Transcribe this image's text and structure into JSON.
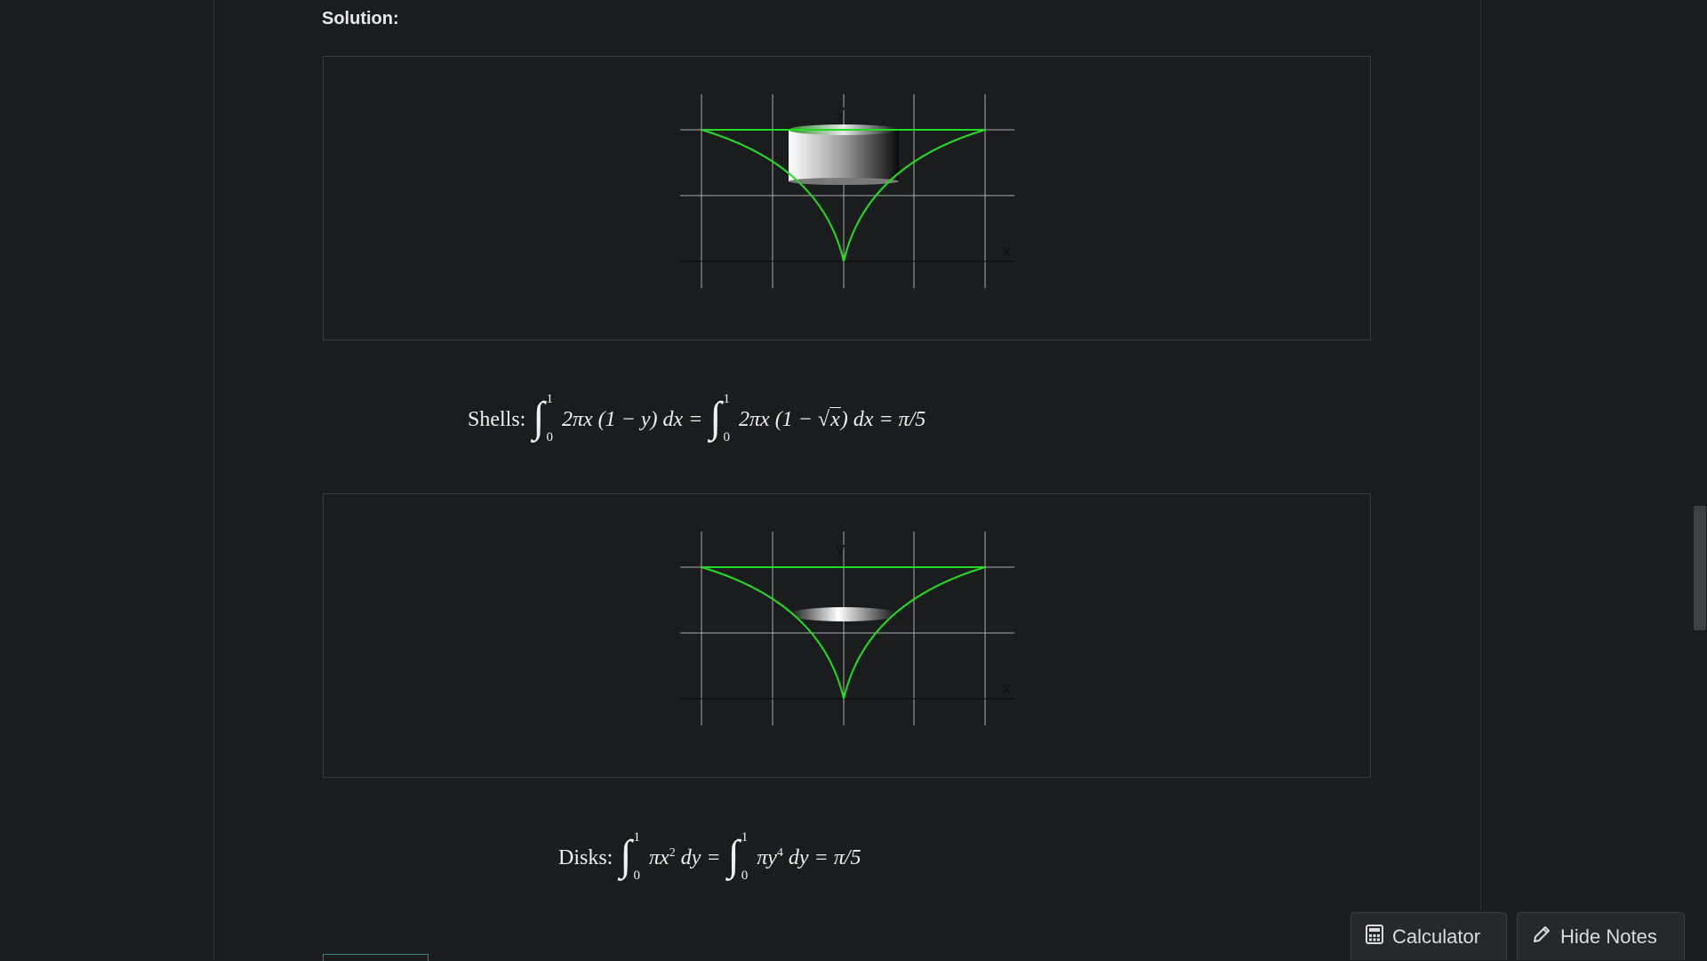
{
  "solution": {
    "label": "Solution:"
  },
  "figures": [
    {
      "y_label": "y",
      "x_label": "x",
      "solid": "shell"
    },
    {
      "y_label": "y",
      "x_label": "x",
      "solid": "disk"
    }
  ],
  "colors": {
    "curve": "#22dd22",
    "grid": "#cfcfcf",
    "background": "#1b1c1e"
  },
  "formulas": {
    "shells": {
      "label": "Shells:",
      "lower": "0",
      "upper": "1",
      "term1": "2πx (1 − y) dx =",
      "term2_a": "2πx (1 − ",
      "term2_sqrt": "x",
      "term2_b": ") dx = π/5"
    },
    "disks": {
      "label": "Disks:",
      "lower": "0",
      "upper": "1",
      "term1_a": "πx",
      "term1_exp": "2",
      "term1_b": "dy =",
      "term2_a": "πy",
      "term2_exp": "4",
      "term2_b": "dy = π/5"
    }
  },
  "buttons": {
    "calculator": {
      "label": "Calculator",
      "icon": "calculator-icon"
    },
    "hide_notes": {
      "label": "Hide Notes",
      "icon": "pencil-icon"
    }
  }
}
